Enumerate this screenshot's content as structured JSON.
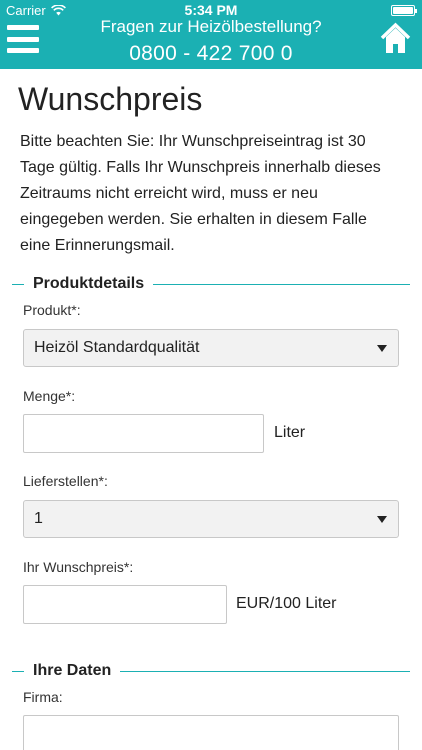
{
  "status_bar": {
    "carrier": "Carrier",
    "time": "5:34 PM"
  },
  "header": {
    "question": "Fragen zur Heizölbestellung?",
    "phone": "0800 - 422 700 0"
  },
  "page": {
    "title": "Wunschpreis",
    "intro": "Bitte beachten Sie: Ihr Wunschpreiseintrag ist 30 Tage gültig. Falls Ihr Wunschpreis innerhalb dieses Zeitraums nicht erreicht wird, muss er neu eingegeben werden. Sie erhalten in diesem Falle eine Erinnerungsmail."
  },
  "produktdetails": {
    "heading": "Produktdetails",
    "produkt": {
      "label": "Produkt*:",
      "value": "Heizöl Standardqualität"
    },
    "menge": {
      "label": "Menge*:",
      "value": "",
      "unit": "Liter"
    },
    "lieferstellen": {
      "label": "Lieferstellen*:",
      "value": "1"
    },
    "wunschpreis": {
      "label": "Ihr Wunschpreis*:",
      "value": "",
      "unit": "EUR/100 Liter"
    }
  },
  "ihre_daten": {
    "heading": "Ihre Daten",
    "firma": {
      "label": "Firma:",
      "value": ""
    }
  },
  "colors": {
    "accent": "#1bb0b3"
  }
}
